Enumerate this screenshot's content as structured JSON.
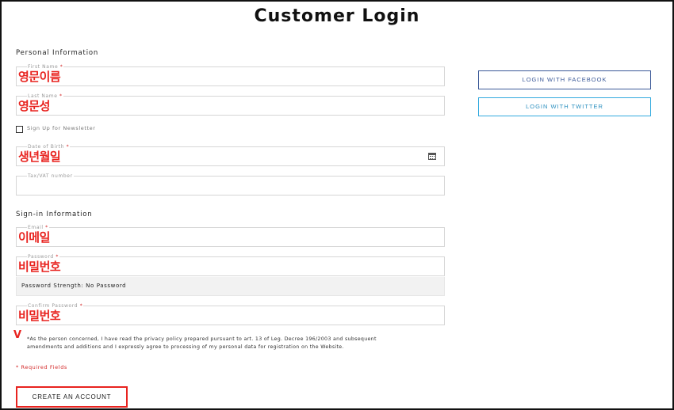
{
  "page": {
    "title": "Customer Login"
  },
  "personal": {
    "section_title": "Personal Information",
    "first_name": {
      "label": "First Name",
      "required": "*",
      "annotation": "영문이름"
    },
    "last_name": {
      "label": "Last Name",
      "required": "*",
      "annotation": "영문성"
    },
    "newsletter_label": "Sign Up for Newsletter",
    "dob": {
      "label": "Date of Birth",
      "required": "*",
      "annotation": "생년월일",
      "icon": "calendar-icon"
    },
    "tax": {
      "label": "Tax/VAT number"
    }
  },
  "signin": {
    "section_title": "Sign-in Information",
    "email": {
      "label": "Email",
      "required": "*",
      "annotation": "이메일"
    },
    "password": {
      "label": "Password",
      "required": "*",
      "annotation": "비밀번호"
    },
    "strength": "Password Strength: No Password",
    "confirm": {
      "label": "Confirm Password",
      "required": "*",
      "annotation": "비밀번호"
    }
  },
  "consent": {
    "mark": "V",
    "text": "*As the person concerned, I have read the privacy policy prepared pursuant to art. 13 of Leg. Decree 196/2003 and subsequent amendments and additions and I expressly agree to processing of my personal data for registration on the Website."
  },
  "required_note": "* Required Fields",
  "create_button": "CREATE AN ACCOUNT",
  "social": {
    "facebook": "LOGIN WITH FACEBOOK",
    "twitter": "LOGIN WITH TWITTER"
  },
  "colors": {
    "annotation": "#e8231f",
    "facebook": "#3b5998",
    "twitter": "#33aadf"
  }
}
